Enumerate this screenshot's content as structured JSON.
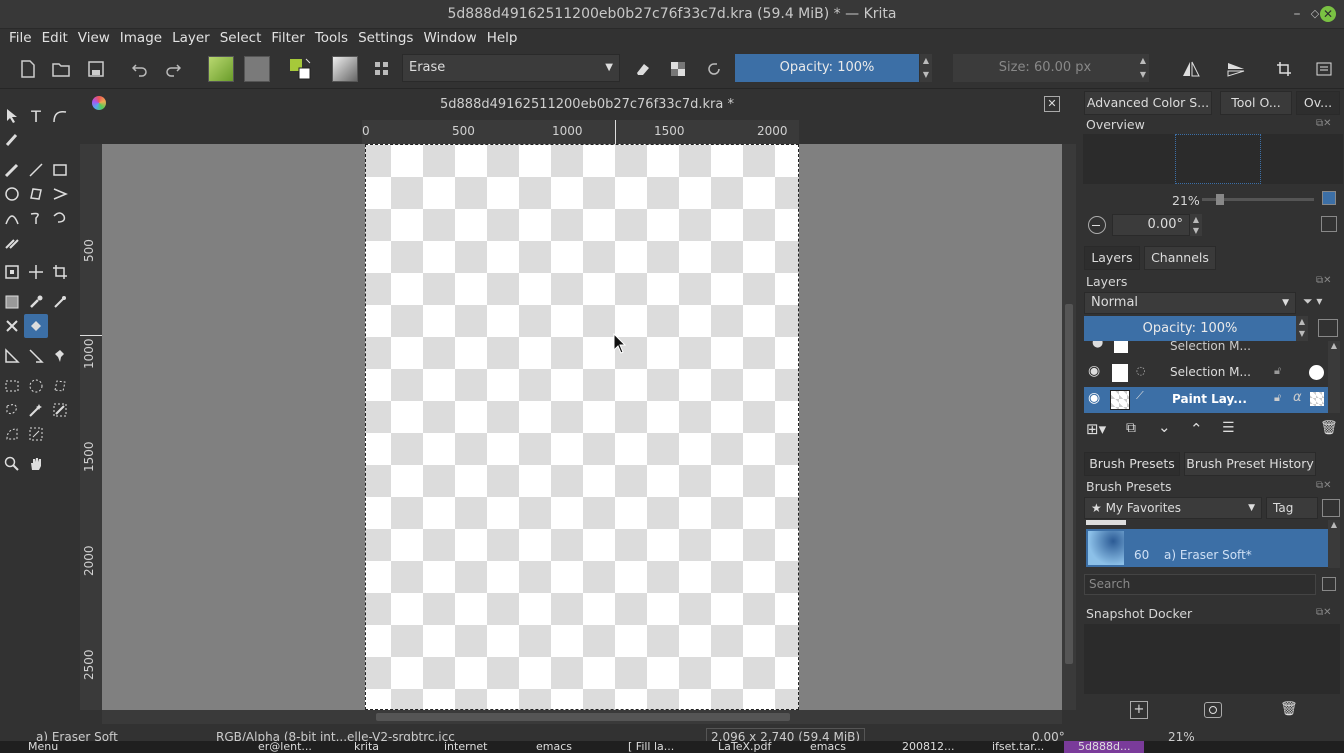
{
  "window": {
    "title": "5d888d49162511200eb0b27c76f33c7d.kra (59.4 MiB)  * — Krita"
  },
  "menu": [
    "File",
    "Edit",
    "View",
    "Image",
    "Layer",
    "Select",
    "Filter",
    "Tools",
    "Settings",
    "Window",
    "Help"
  ],
  "toolbar": {
    "blend_mode": "Erase",
    "opacity": "Opacity: 100%",
    "size": "Size: 60.00 px"
  },
  "document": {
    "tab_title": "5d888d49162511200eb0b27c76f33c7d.kra *"
  },
  "ruler_h": [
    "0",
    "500",
    "1000",
    "1500",
    "2000"
  ],
  "ruler_v": [
    "500",
    "1000",
    "1500",
    "2000",
    "2500"
  ],
  "dock": {
    "top_tabs": [
      "Advanced Color S...",
      "Tool O...",
      "Ov..."
    ],
    "overview_title": "Overview",
    "zoom": "21%",
    "rotation": "0.00°",
    "layers_tabs": [
      "Layers",
      "Channels"
    ],
    "layers_title": "Layers",
    "layer_blend": "Normal",
    "layer_opacity": "Opacity:  100%",
    "layers": [
      {
        "name": "Selection M..."
      },
      {
        "name": "Selection M..."
      },
      {
        "name": "Paint Lay..."
      }
    ],
    "brush_tabs": [
      "Brush Presets",
      "Brush Preset History"
    ],
    "brush_title": "Brush Presets",
    "brush_tag": "★ My Favorites",
    "tag_btn": "Tag",
    "preset_size": "60",
    "preset_name": "a) Eraser Soft*",
    "search_placeholder": "Search",
    "snapshot_title": "Snapshot Docker"
  },
  "status": {
    "brush": "a) Eraser Soft",
    "colorspace": "RGB/Alpha (8-bit int...elle-V2-srgbtrc.icc",
    "dims": "2,096 x 2,740 (59.4 MiB)",
    "rotation": "0.00°",
    "zoom": "21%"
  },
  "taskbar": [
    "Menu",
    "er@lent...",
    "krita",
    "internet",
    "emacs",
    "[ Fill la...",
    "LaTeX.pdf",
    "emacs",
    "200812...",
    "ifset.tar...",
    "5d888d..."
  ],
  "colors": {
    "accent": "#3c6fa6",
    "canvas_bg": "#808080",
    "panel": "#323232"
  }
}
